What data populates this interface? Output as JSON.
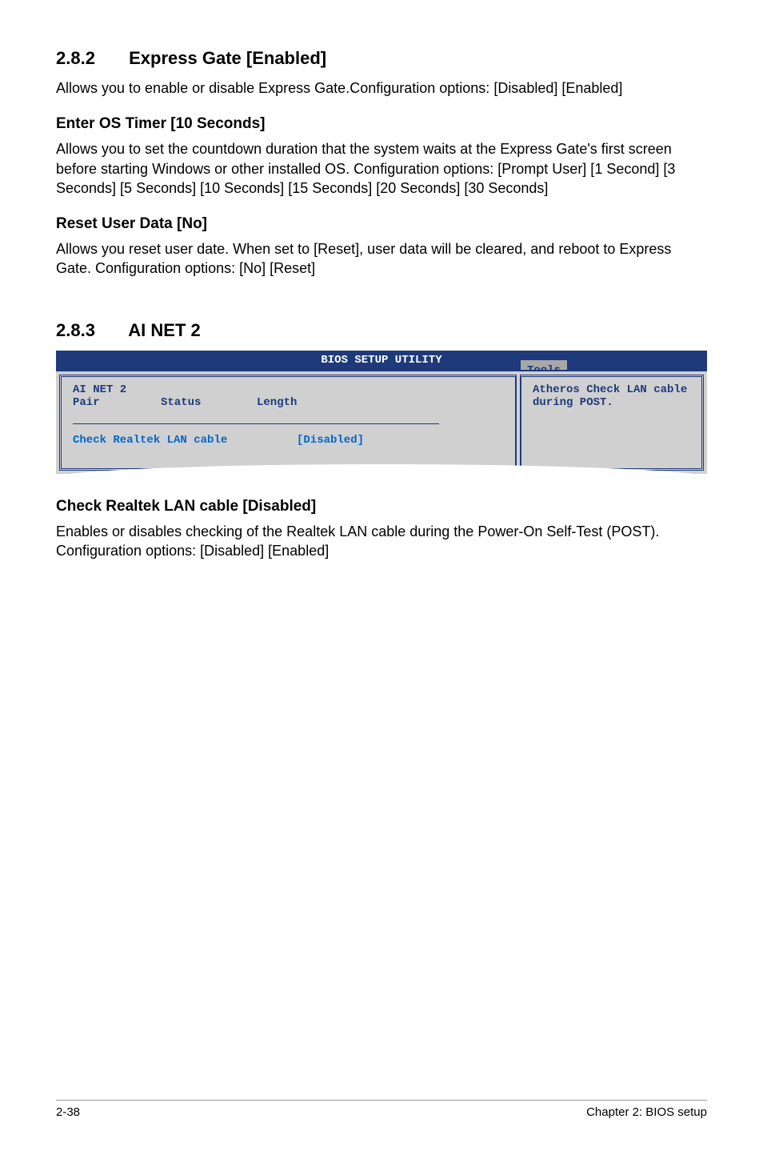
{
  "section_282": {
    "num": "2.8.2",
    "title": "Express Gate [Enabled]",
    "body": "Allows you to enable or disable Express Gate.Configuration options: [Disabled] [Enabled]"
  },
  "enter_os": {
    "heading": "Enter OS Timer [10 Seconds]",
    "body": "Allows you to set the countdown duration that the system waits at the Express Gate's first screen before starting Windows or other installed OS. Configuration options: [Prompt User] [1 Second] [3 Seconds] [5 Seconds] [10 Seconds] [15 Seconds] [20 Seconds] [30 Seconds]"
  },
  "reset_user": {
    "heading": "Reset User Data [No]",
    "body": "Allows you reset user date. When set to [Reset], user data will be cleared, and reboot to Express Gate. Configuration options: [No] [Reset]"
  },
  "section_283": {
    "num": "2.8.3",
    "title": "AI NET 2"
  },
  "bios": {
    "header": "BIOS SETUP UTILITY",
    "tab": "Tools",
    "left": {
      "header_line1": "AI NET 2",
      "header_line2_col1": "Pair",
      "header_line2_col2": "Status",
      "header_line2_col3": "Length",
      "setting_label": "Check Realtek LAN cable",
      "setting_value": "[Disabled]"
    },
    "right": "Atheros Check LAN cable during POST."
  },
  "check_realtek": {
    "heading": "Check Realtek LAN cable [Disabled]",
    "body": "Enables or disables checking of the Realtek LAN cable during the Power-On Self-Test (POST). Configuration options: [Disabled] [Enabled]"
  },
  "footer": {
    "left": "2-38",
    "right": "Chapter 2: BIOS setup"
  }
}
